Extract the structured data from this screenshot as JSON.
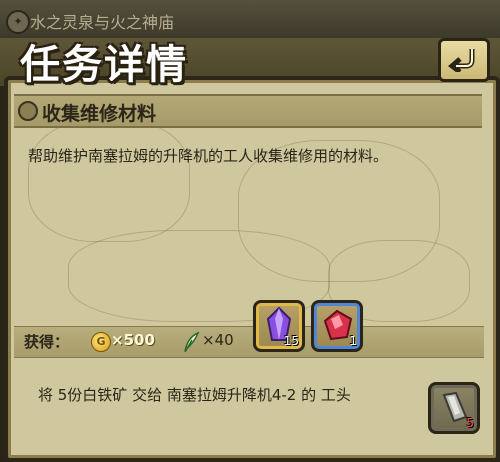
{
  "top": {
    "quest_name": "水之灵泉与火之神庙"
  },
  "header": {
    "title": "任务详情",
    "back_icon": "return-arrow-icon"
  },
  "task": {
    "name": "收集维修材料",
    "description": "帮助维护南塞拉姆的升降机的工人收集维修用的材料。"
  },
  "rewards": {
    "label": "获得：",
    "coin_amount": "×500",
    "xp_amount": "×40",
    "items": [
      {
        "icon": "purple-crystal-icon",
        "count": "15",
        "frame_color": "#e1b948"
      },
      {
        "icon": "red-ore-icon",
        "count": "1",
        "frame_color": "#4f86d8"
      }
    ]
  },
  "objective": {
    "text": "将 5份白铁矿 交给 南塞拉姆升降机4-2 的 工头",
    "item": {
      "icon": "white-iron-ore-icon",
      "count": "5"
    }
  },
  "colors": {
    "panel": "#cfc89f",
    "frame": "#2c2618",
    "gold_accent": "#e1b948",
    "blue_accent": "#4f86d8"
  }
}
